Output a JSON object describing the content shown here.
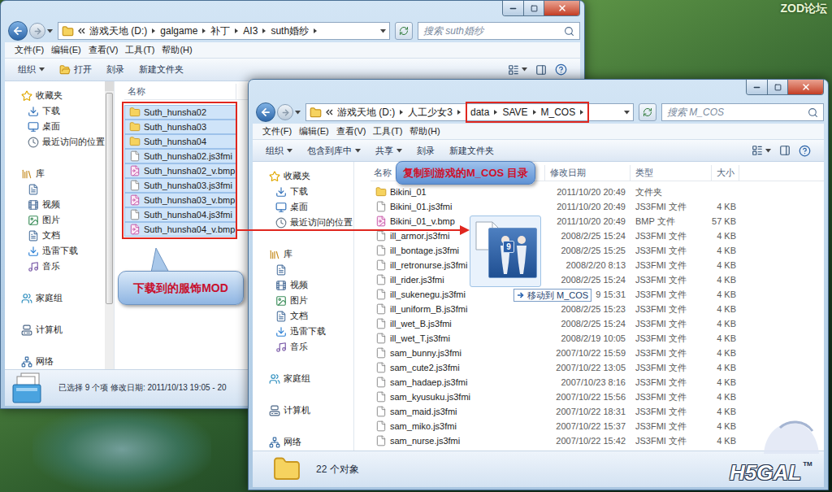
{
  "desktop": {
    "watermark": "ZOD论坛",
    "logo": "H5GAL",
    "logo_mark": "TM"
  },
  "windows": [
    {
      "address": {
        "path": [
          {
            "label": "游戏天地 (D:)",
            "highlighted": false
          },
          {
            "label": "galgame",
            "highlighted": false
          },
          {
            "label": "补丁",
            "highlighted": false
          },
          {
            "label": "AI3",
            "highlighted": false
          },
          {
            "label": "suth婚纱",
            "highlighted": false
          }
        ]
      },
      "search": {
        "placeholder": "搜索 suth婚纱"
      },
      "menu": [
        "文件(F)",
        "编辑(E)",
        "查看(V)",
        "工具(T)",
        "帮助(H)"
      ],
      "toolbar": [
        {
          "label": "组织",
          "dropdown": true,
          "kind": "plain"
        },
        {
          "label": "打开",
          "dropdown": false,
          "kind": "open"
        },
        {
          "label": "刻录",
          "dropdown": false,
          "kind": "plain"
        },
        {
          "label": "新建文件夹",
          "dropdown": false,
          "kind": "plain"
        }
      ],
      "nav": [
        {
          "label": "收藏夹",
          "kind": "group"
        },
        {
          "label": "下载",
          "kind": "item"
        },
        {
          "label": "桌面",
          "kind": "item"
        },
        {
          "label": "最近访问的位置",
          "kind": "item"
        },
        {
          "label": "库",
          "kind": "group"
        },
        {
          "kind": "blank"
        },
        {
          "label": "视频",
          "kind": "item"
        },
        {
          "label": "图片",
          "kind": "item"
        },
        {
          "label": "文档",
          "kind": "item"
        },
        {
          "label": "迅雷下载",
          "kind": "item"
        },
        {
          "label": "音乐",
          "kind": "item"
        },
        {
          "label": "家庭组",
          "kind": "group"
        },
        {
          "label": "计算机",
          "kind": "group"
        },
        {
          "label": "网络",
          "kind": "group"
        }
      ],
      "columns": [
        "名称"
      ],
      "files_marked": true,
      "files": [
        {
          "name": "Suth_hunsha02",
          "kind": "folder",
          "selected": true
        },
        {
          "name": "Suth_hunsha03",
          "kind": "folder",
          "selected": true
        },
        {
          "name": "Suth_hunsha04",
          "kind": "folder",
          "selected": true
        },
        {
          "name": "Suth_hunsha02.js3fmi",
          "kind": "file",
          "selected": true
        },
        {
          "name": "Suth_hunsha02_v.bmp",
          "kind": "image",
          "selected": true
        },
        {
          "name": "Suth_hunsha03.js3fmi",
          "kind": "file",
          "selected": true
        },
        {
          "name": "Suth_hunsha03_v.bmp",
          "kind": "image",
          "selected": true
        },
        {
          "name": "Suth_hunsha04.js3fmi",
          "kind": "file",
          "selected": true
        },
        {
          "name": "Suth_hunsha04_v.bmp",
          "kind": "image",
          "selected": true
        }
      ],
      "status": "已选择 9 个项 修改日期: 2011/10/13 19:05 - 20"
    },
    {
      "address": {
        "path": [
          {
            "label": "游戏天地 (D:)",
            "highlighted": false
          },
          {
            "label": "人工少女3",
            "highlighted": false
          },
          {
            "label": "data",
            "highlighted": true
          },
          {
            "label": "SAVE",
            "highlighted": true
          },
          {
            "label": "M_COS",
            "highlighted": true
          }
        ]
      },
      "search": {
        "placeholder": "搜索 M_COS"
      },
      "menu": [
        "文件(F)",
        "编辑(E)",
        "查看(V)",
        "工具(T)",
        "帮助(H)"
      ],
      "toolbar": [
        {
          "label": "组织",
          "dropdown": true,
          "kind": "plain"
        },
        {
          "label": "包含到库中",
          "dropdown": true,
          "kind": "plain"
        },
        {
          "label": "共享",
          "dropdown": true,
          "kind": "plain"
        },
        {
          "label": "刻录",
          "dropdown": false,
          "kind": "plain"
        },
        {
          "label": "新建文件夹",
          "dropdown": false,
          "kind": "plain"
        }
      ],
      "nav": [
        {
          "label": "收藏夹",
          "kind": "group"
        },
        {
          "label": "下载",
          "kind": "item"
        },
        {
          "label": "桌面",
          "kind": "item"
        },
        {
          "label": "最近访问的位置",
          "kind": "item"
        },
        {
          "label": "库",
          "kind": "group"
        },
        {
          "kind": "blank"
        },
        {
          "label": "视频",
          "kind": "item"
        },
        {
          "label": "图片",
          "kind": "item"
        },
        {
          "label": "文档",
          "kind": "item"
        },
        {
          "label": "迅雷下载",
          "kind": "item"
        },
        {
          "label": "音乐",
          "kind": "item"
        },
        {
          "label": "家庭组",
          "kind": "group"
        },
        {
          "label": "计算机",
          "kind": "group"
        },
        {
          "label": "网络",
          "kind": "group"
        }
      ],
      "columns": [
        "名称",
        "修改日期",
        "类型",
        "大小"
      ],
      "files_marked": false,
      "files": [
        {
          "name": "Bikini_01",
          "date": "2011/10/20 20:49",
          "type": "文件夹",
          "kind": "folder",
          "selected": false
        },
        {
          "name": "Bikini_01.js3fmi",
          "date": "2011/10/20 20:49",
          "type": "JS3FMI 文件",
          "size": "4 KB",
          "kind": "file",
          "selected": false
        },
        {
          "name": "Bikini_01_v.bmp",
          "date": "2011/10/20 20:49",
          "type": "BMP 文件",
          "size": "57 KB",
          "kind": "image",
          "selected": false
        },
        {
          "name": "ill_armor.js3fmi",
          "date": "2008/2/25 15:24",
          "type": "JS3FMI 文件",
          "size": "4 KB",
          "kind": "file",
          "selected": false
        },
        {
          "name": "ill_bontage.js3fmi",
          "date": "2008/2/25 15:25",
          "type": "JS3FMI 文件",
          "size": "4 KB",
          "kind": "file",
          "selected": false
        },
        {
          "name": "ill_retronurse.js3fmi",
          "date": "2008/2/20 8:13",
          "type": "JS3FMI 文件",
          "size": "4 KB",
          "kind": "file",
          "selected": false
        },
        {
          "name": "ill_rider.js3fmi",
          "date": "2008/2/25 15:24",
          "type": "JS3FMI 文件",
          "size": "4 KB",
          "kind": "file",
          "selected": false
        },
        {
          "name": "ill_sukenegu.js3fmi",
          "date": "9 15:31",
          "type": "JS3FMI 文件",
          "size": "4 KB",
          "kind": "file",
          "selected": false
        },
        {
          "name": "ill_uniform_B.js3fmi",
          "date": "2008/2/25 15:23",
          "type": "JS3FMI 文件",
          "size": "4 KB",
          "kind": "file",
          "selected": false
        },
        {
          "name": "ill_wet_B.js3fmi",
          "date": "2008/2/25 15:24",
          "type": "JS3FMI 文件",
          "size": "4 KB",
          "kind": "file",
          "selected": false
        },
        {
          "name": "ill_wet_T.js3fmi",
          "date": "2008/2/19 10:05",
          "type": "JS3FMI 文件",
          "size": "4 KB",
          "kind": "file",
          "selected": false
        },
        {
          "name": "sam_bunny.js3fmi",
          "date": "2007/10/22 15:59",
          "type": "JS3FMI 文件",
          "size": "4 KB",
          "kind": "file",
          "selected": false
        },
        {
          "name": "sam_cute2.js3fmi",
          "date": "2007/10/22 13:05",
          "type": "JS3FMI 文件",
          "size": "4 KB",
          "kind": "file",
          "selected": false
        },
        {
          "name": "sam_hadaep.js3fmi",
          "date": "2007/10/23 8:16",
          "type": "JS3FMI 文件",
          "size": "4 KB",
          "kind": "file",
          "selected": false
        },
        {
          "name": "sam_kyusuku.js3fmi",
          "date": "2007/10/22 15:56",
          "type": "JS3FMI 文件",
          "size": "4 KB",
          "kind": "file",
          "selected": false
        },
        {
          "name": "sam_maid.js3fmi",
          "date": "2007/10/22 18:31",
          "type": "JS3FMI 文件",
          "size": "4 KB",
          "kind": "file",
          "selected": false
        },
        {
          "name": "sam_miko.js3fmi",
          "date": "2007/10/22 15:37",
          "type": "JS3FMI 文件",
          "size": "4 KB",
          "kind": "file",
          "selected": false
        },
        {
          "name": "sam_nurse.js3fmi",
          "date": "2007/10/22 15:42",
          "type": "JS3FMI 文件",
          "size": "4 KB",
          "kind": "file",
          "selected": false
        }
      ],
      "status": "22 个对象"
    }
  ],
  "annotations": {
    "source_callout": "下载到的服饰MOD",
    "target_callout": "复制到游戏的M_COS 目录",
    "drag": {
      "count": "9",
      "tooltip": "移动到 M_COS"
    }
  }
}
